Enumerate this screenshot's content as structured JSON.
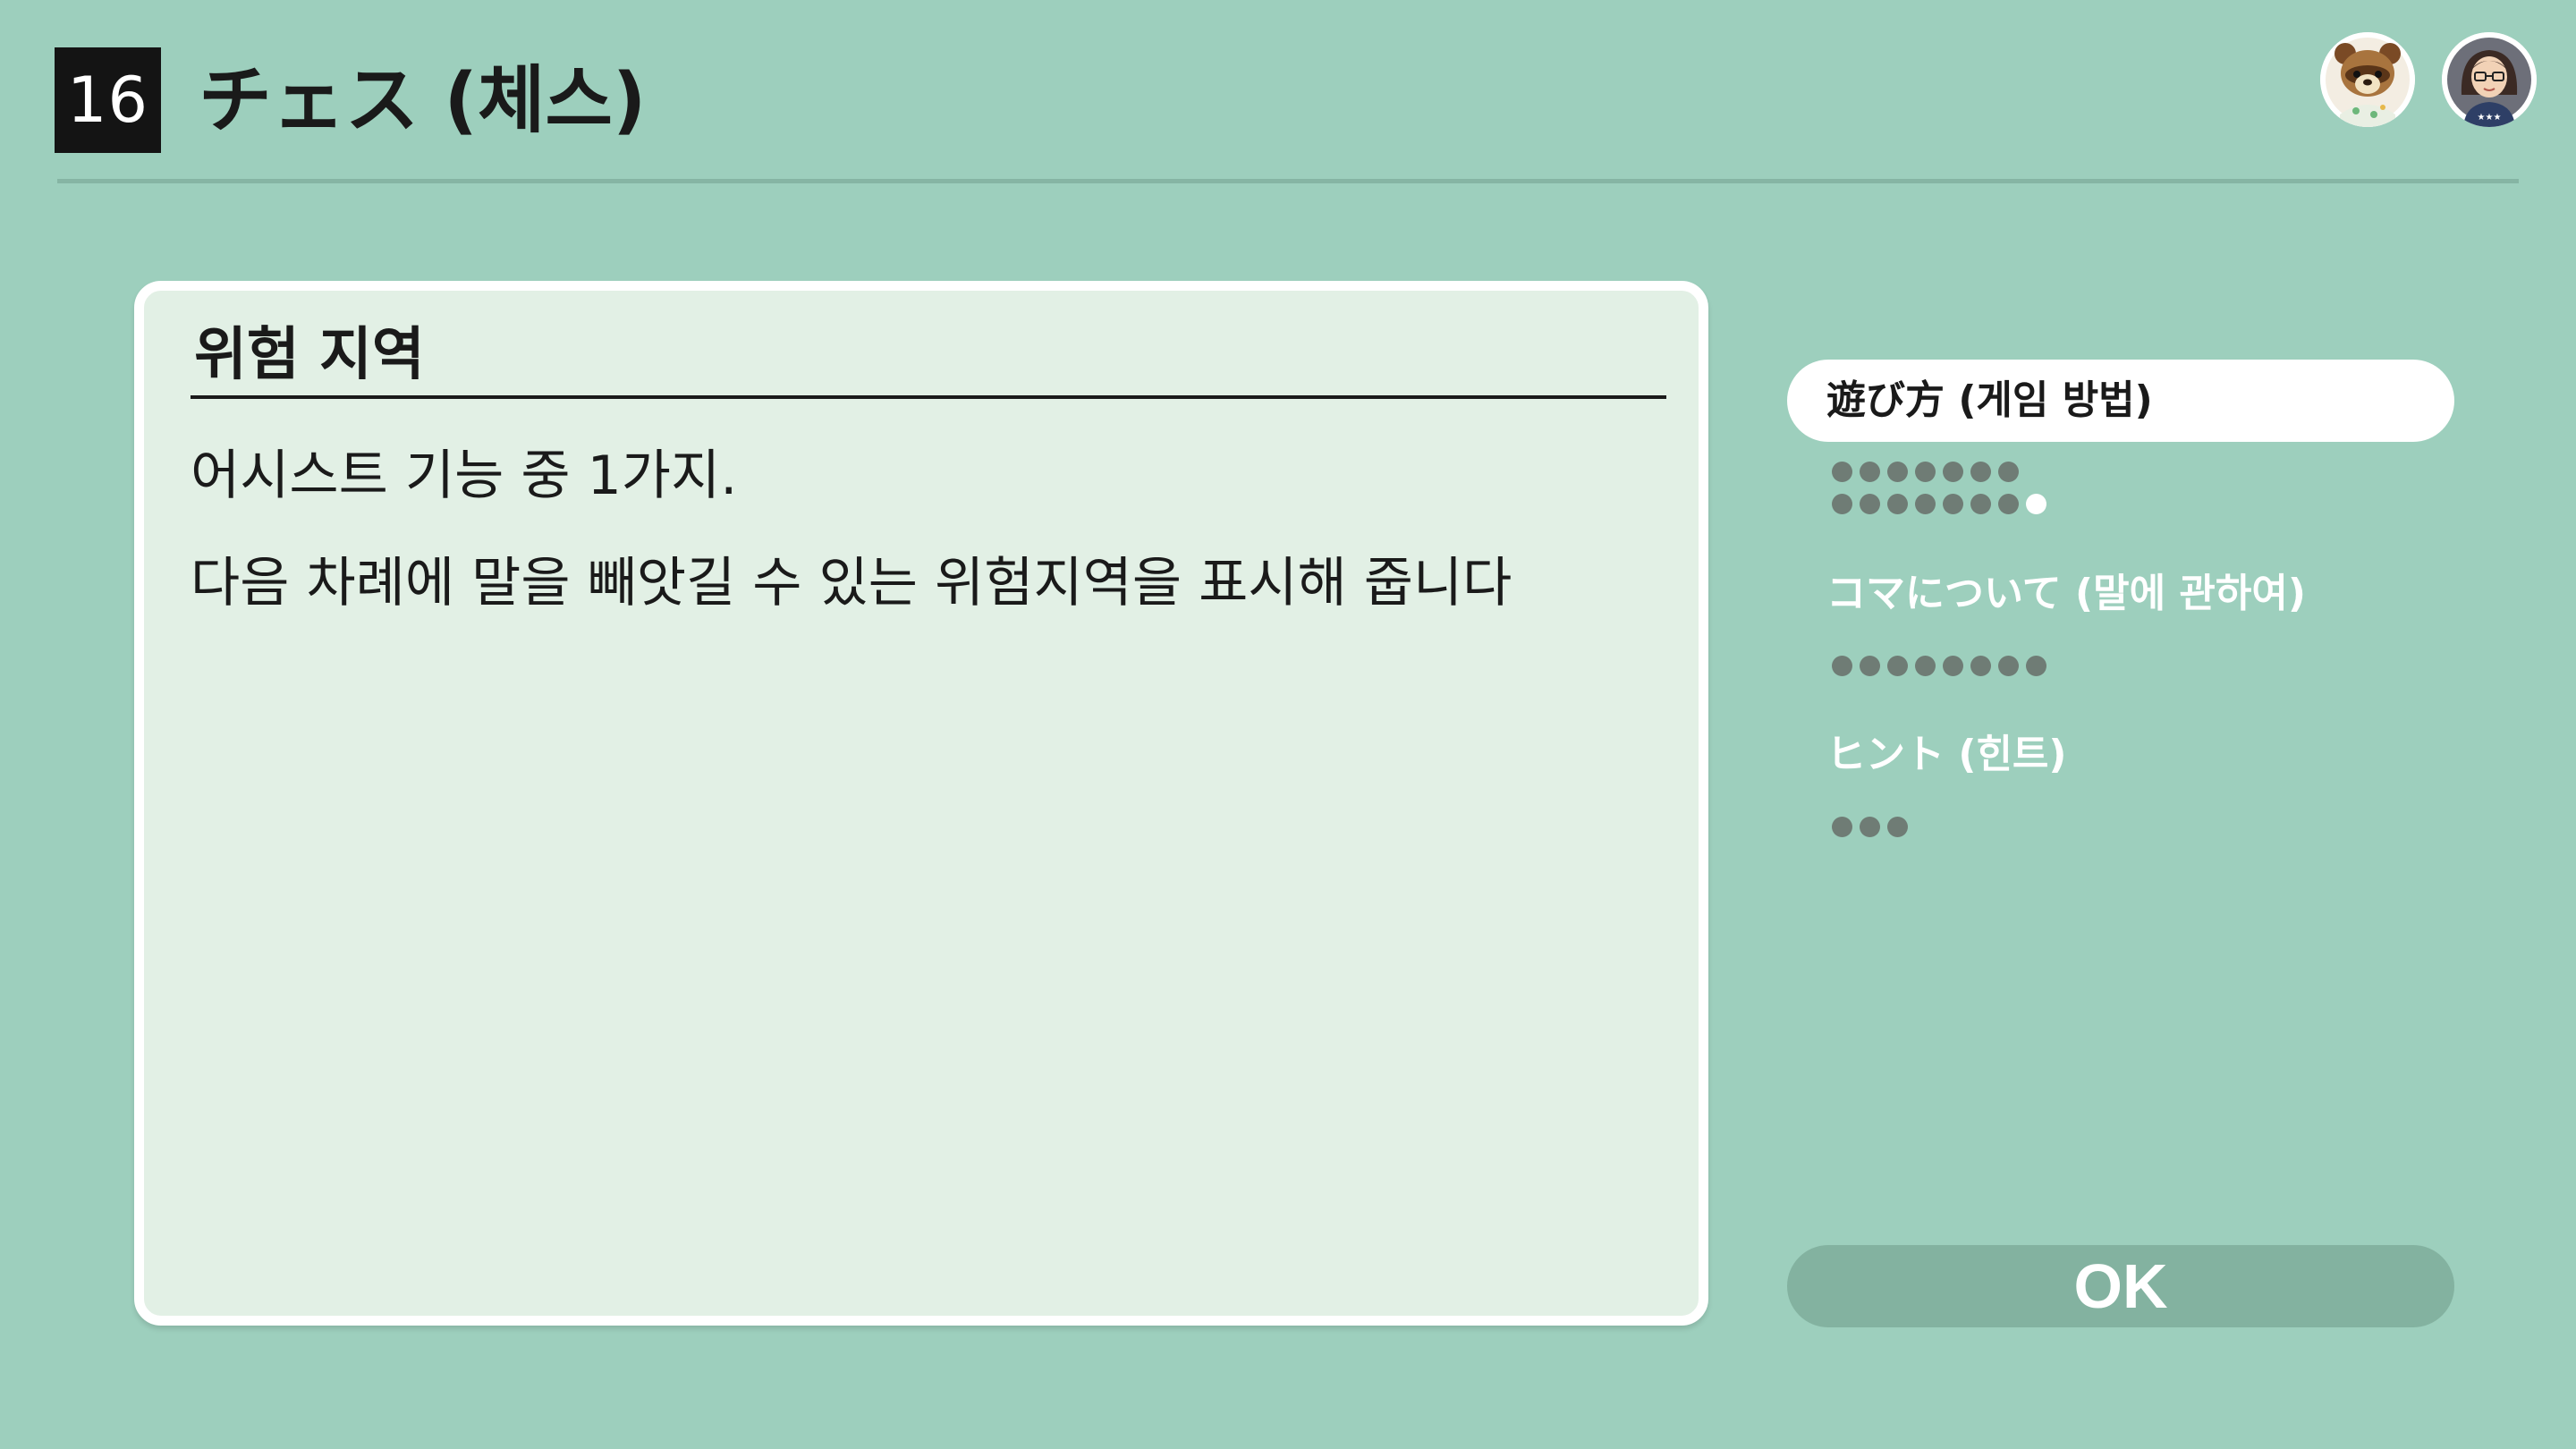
{
  "header": {
    "game_number": "16",
    "title": "チェス (체스)"
  },
  "avatars": [
    {
      "icon": "tanuki-character-icon"
    },
    {
      "icon": "player-mii-icon"
    }
  ],
  "card": {
    "heading": "위험 지역",
    "lines": [
      "어시스트 기능 중 1가지.",
      "다음 차례에 말을 빼앗길 수 있는 위험지역을 표시해 줍니다"
    ]
  },
  "menu": {
    "items": [
      {
        "label": "遊び方 (게임 방법)",
        "selected": true,
        "pages": 15,
        "current_page": 15
      },
      {
        "label": "コマについて (말에 관하여)",
        "selected": false,
        "pages": 8
      },
      {
        "label": "ヒント (힌트)",
        "selected": false,
        "pages": 3
      }
    ]
  },
  "ok_button": {
    "label": "OK"
  },
  "colors": {
    "background": "#9dcfbd",
    "card": "#e2f0e5",
    "dot": "#6f7c75",
    "ok_button": "#83b2a0"
  }
}
